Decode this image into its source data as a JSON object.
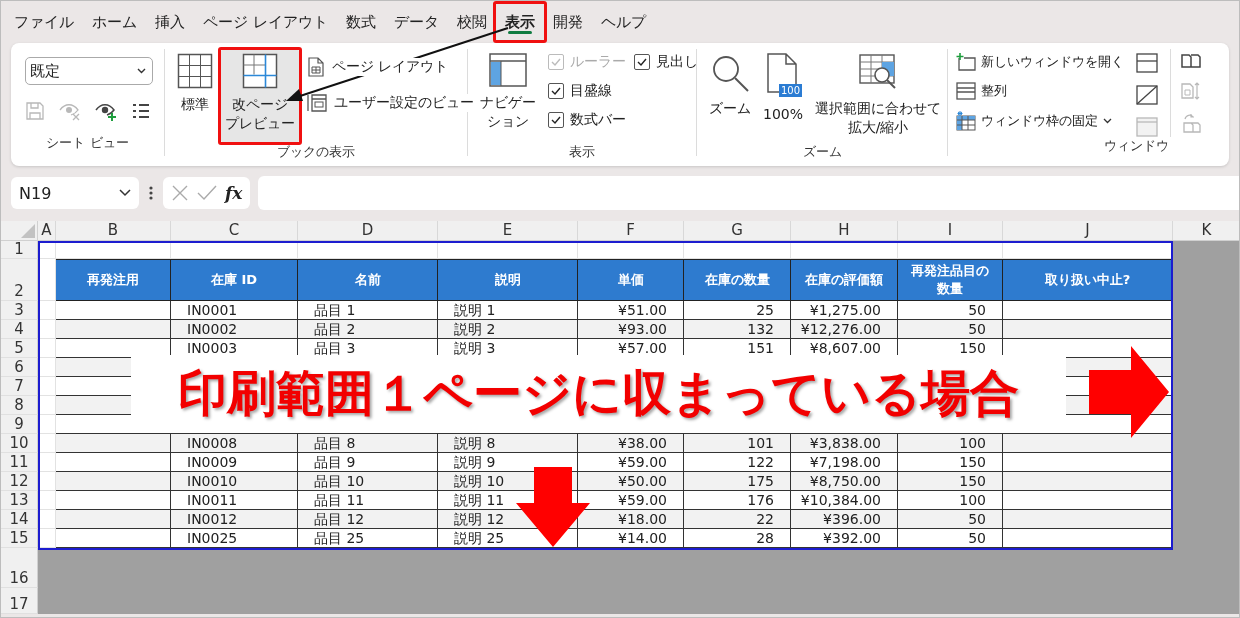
{
  "tabs": [
    {
      "label": "ファイル",
      "selected": false,
      "callout": false
    },
    {
      "label": "ホーム",
      "selected": false,
      "callout": false
    },
    {
      "label": "挿入",
      "selected": false,
      "callout": false
    },
    {
      "label": "ページ レイアウト",
      "selected": false,
      "callout": false
    },
    {
      "label": "数式",
      "selected": false,
      "callout": false
    },
    {
      "label": "データ",
      "selected": false,
      "callout": false
    },
    {
      "label": "校閲",
      "selected": false,
      "callout": false
    },
    {
      "label": "表示",
      "selected": true,
      "callout": true
    },
    {
      "label": "開発",
      "selected": false,
      "callout": false
    },
    {
      "label": "ヘルプ",
      "selected": false,
      "callout": false
    }
  ],
  "ribbon": {
    "sheet_view": {
      "label": "シート ビュー",
      "view": "既定",
      "tools": [
        {
          "kind": "save",
          "disabled": true
        },
        {
          "kind": "exit",
          "disabled": true
        },
        {
          "kind": "new",
          "disabled": false
        },
        {
          "kind": "options",
          "disabled": false
        }
      ]
    },
    "workbook_views": {
      "label": "ブックの表示",
      "large": [
        {
          "kind": "normal",
          "lines": [
            "標準"
          ],
          "selected": false,
          "callout": false
        },
        {
          "kind": "page_break",
          "lines": [
            "改ページ",
            "プレビュー"
          ],
          "selected": true,
          "callout": true
        }
      ],
      "small": [
        {
          "kind": "page_layout",
          "label": "ページ レイアウト"
        },
        {
          "kind": "custom",
          "label": "ユーザー設定のビュー"
        }
      ]
    },
    "show": {
      "label": "表示",
      "navigation": [
        "ナビゲー",
        "ション"
      ],
      "checks": [
        {
          "label": "ルーラー",
          "checked": true,
          "disabled": true
        },
        {
          "label": "目盛線",
          "checked": true,
          "disabled": false
        },
        {
          "label": "数式バー",
          "checked": true,
          "disabled": false
        },
        {
          "label": "見出し",
          "checked": true,
          "disabled": false
        }
      ]
    },
    "zoom": {
      "label": "ズーム",
      "buttons": [
        {
          "kind": "zoom",
          "lines": [
            "ズーム"
          ]
        },
        {
          "kind": "hundred",
          "lines": [
            "100%"
          ],
          "icon_text": "100"
        },
        {
          "kind": "selection",
          "lines": [
            "選択範囲に合わせて",
            "拡大/縮小"
          ]
        }
      ]
    },
    "window": {
      "label": "ウィンドウ",
      "commands": [
        {
          "kind": "new_window",
          "label": "新しいウィンドウを開く",
          "dropdown": false
        },
        {
          "kind": "arrange",
          "label": "整列",
          "dropdown": false
        },
        {
          "kind": "freeze",
          "label": "ウィンドウ枠の固定",
          "dropdown": true
        }
      ],
      "tools": [
        {
          "kind": "split",
          "disabled": false
        },
        {
          "kind": "hide",
          "disabled": false
        },
        {
          "kind": "unhide",
          "disabled": true
        },
        {
          "kind": "side_by_side",
          "disabled": false
        },
        {
          "kind": "sync",
          "disabled": true
        },
        {
          "kind": "reset",
          "disabled": true
        }
      ]
    }
  },
  "formula_bar": {
    "name_box": "N19",
    "function_label": "fx"
  },
  "sheet": {
    "columns": [
      "A",
      "B",
      "C",
      "D",
      "E",
      "F",
      "G",
      "H",
      "I",
      "J",
      "K"
    ],
    "rows": [
      {
        "number": "1",
        "kind": "blank"
      },
      {
        "number": "2",
        "kind": "header",
        "cells": [
          [
            "再発注用"
          ],
          [
            "在庫 ID"
          ],
          [
            "名前"
          ],
          [
            "説明"
          ],
          [
            "単価"
          ],
          [
            "在庫の数量"
          ],
          [
            "在庫の評価額"
          ],
          [
            "再発注品目の",
            "数量"
          ],
          [
            "取り扱い中止?"
          ]
        ]
      },
      {
        "number": "3",
        "kind": "data",
        "cells": [
          "IN0001",
          "品目 1",
          "説明 1",
          "¥51.00",
          "25",
          "¥1,275.00",
          "50"
        ]
      },
      {
        "number": "4",
        "kind": "data",
        "cells": [
          "IN0002",
          "品目 2",
          "説明 2",
          "¥93.00",
          "132",
          "¥12,276.00",
          "50"
        ]
      },
      {
        "number": "5",
        "kind": "data",
        "cells": [
          "IN0003",
          "品目 3",
          "説明 3",
          "¥57.00",
          "151",
          "¥8,607.00",
          "150"
        ]
      },
      {
        "number": "6",
        "kind": "covered"
      },
      {
        "number": "7",
        "kind": "covered"
      },
      {
        "number": "8",
        "kind": "covered"
      },
      {
        "number": "9",
        "kind": "covered"
      },
      {
        "number": "10",
        "kind": "data",
        "cells": [
          "IN0008",
          "品目 8",
          "説明 8",
          "¥38.00",
          "101",
          "¥3,838.00",
          "100"
        ]
      },
      {
        "number": "11",
        "kind": "data",
        "cells": [
          "IN0009",
          "品目 9",
          "説明 9",
          "¥59.00",
          "122",
          "¥7,198.00",
          "150"
        ]
      },
      {
        "number": "12",
        "kind": "data",
        "cells": [
          "IN0010",
          "品目 10",
          "説明 10",
          "¥50.00",
          "175",
          "¥8,750.00",
          "150"
        ]
      },
      {
        "number": "13",
        "kind": "data",
        "cells": [
          "IN0011",
          "品目 11",
          "説明 11",
          "¥59.00",
          "176",
          "¥10,384.00",
          "100"
        ]
      },
      {
        "number": "14",
        "kind": "data",
        "cells": [
          "IN0012",
          "品目 12",
          "説明 12",
          "¥18.00",
          "22",
          "¥396.00",
          "50"
        ]
      },
      {
        "number": "15",
        "kind": "data",
        "cells": [
          "IN0025",
          "品目 25",
          "説明 25",
          "¥14.00",
          "28",
          "¥392.00",
          "50"
        ]
      },
      {
        "number": "16",
        "kind": "outside"
      },
      {
        "number": "17",
        "kind": "outside"
      }
    ]
  },
  "banner": {
    "text": "印刷範囲１ページに収まっている場合"
  }
}
